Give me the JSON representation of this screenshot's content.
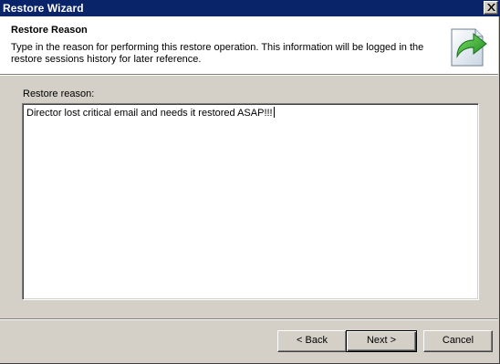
{
  "window": {
    "title": "Restore Wizard"
  },
  "header": {
    "title": "Restore Reason",
    "description": "Type in the reason for performing this restore operation. This information will be logged in the restore sessions history for later reference.",
    "icon": "document-restore-arrow-icon"
  },
  "form": {
    "reason_label": "Restore reason:",
    "reason_value": "Director lost critical email and needs it restored ASAP!!!"
  },
  "buttons": {
    "back": "< Back",
    "next": "Next >",
    "cancel": "Cancel"
  },
  "colors": {
    "titlebar": "#0a246a",
    "dialog_bg": "#d4d0c8",
    "arrow_green": "#3aa832"
  }
}
